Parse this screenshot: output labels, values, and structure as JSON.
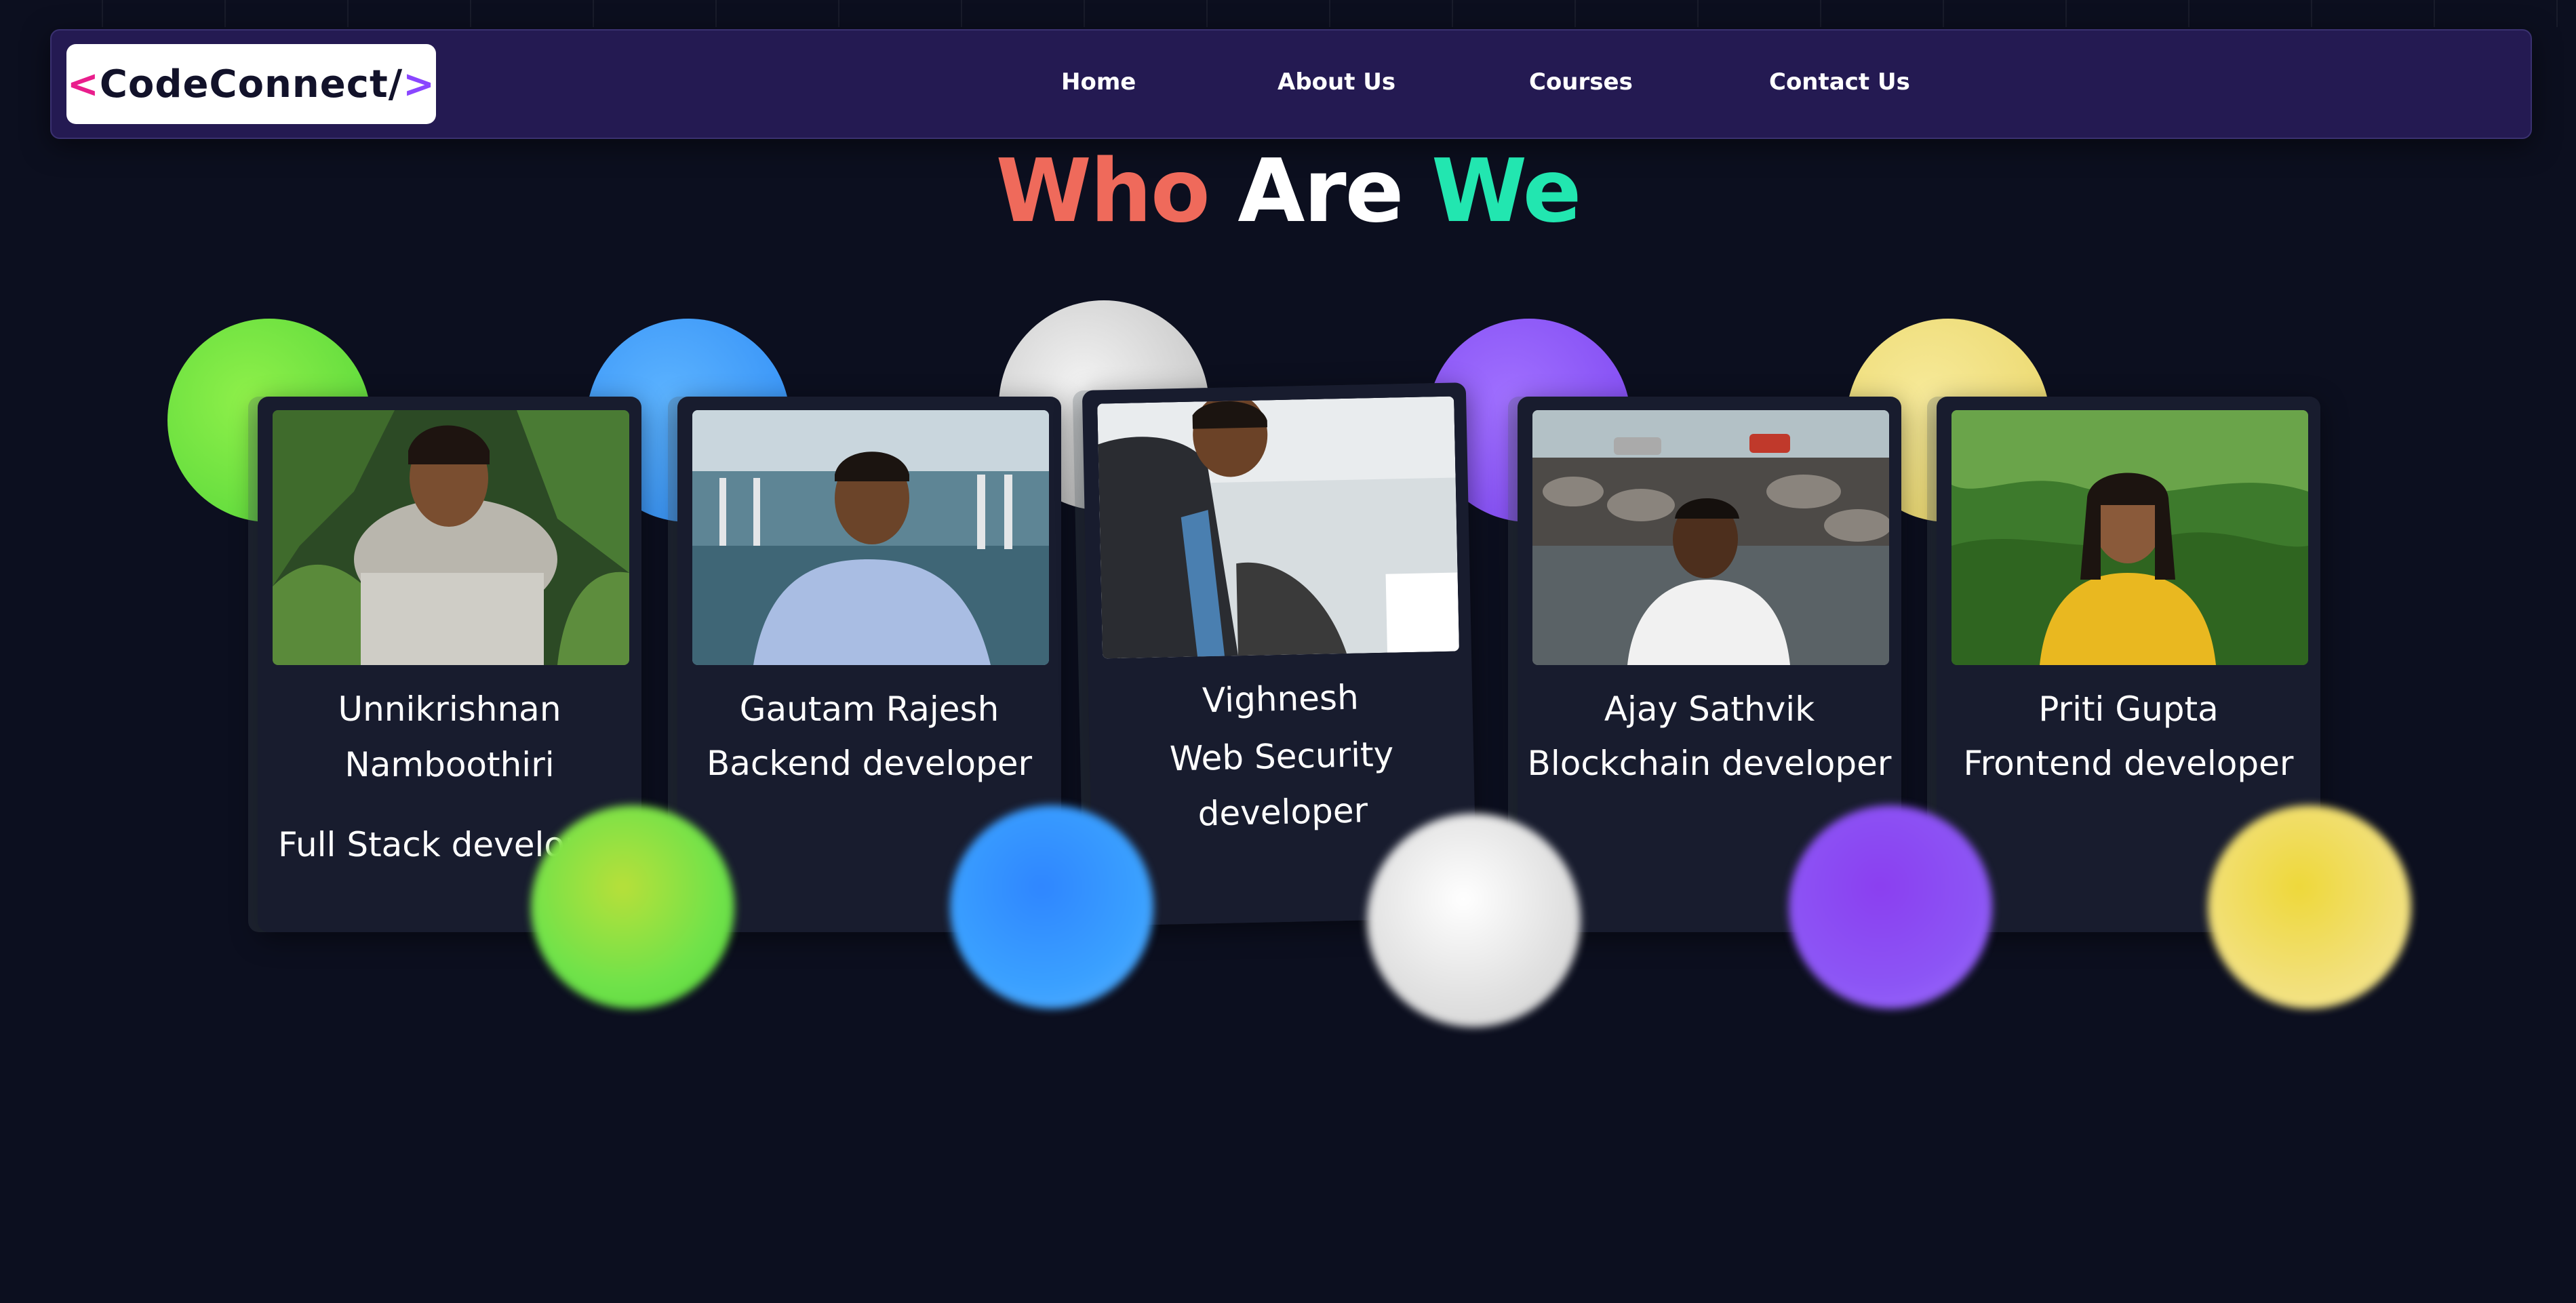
{
  "brand": {
    "logo_open": "<",
    "logo_text": "CodeConnect/",
    "logo_close": ">"
  },
  "nav": {
    "home": "Home",
    "about": "About Us",
    "courses": "Courses",
    "contact": "Contact Us"
  },
  "heading": {
    "word1": "Who",
    "word2": "Are",
    "word3": "We"
  },
  "team": [
    {
      "name": "Unnikrishnan Namboothiri",
      "role": "Full Stack developer",
      "accent": "#6fe24a",
      "photo_desc": "man-in-white-jacket"
    },
    {
      "name": "Gautam Rajesh",
      "role": "Backend developer",
      "accent": "#3aa0ff",
      "photo_desc": "man-in-blue-shirt-at-harbor"
    },
    {
      "name": "Vighnesh",
      "role": "Web Security developer",
      "accent": "#d9d9d9",
      "photo_desc": "man-on-boat"
    },
    {
      "name": "Ajay Sathvik",
      "role": "Blockchain developer",
      "accent": "#8c55f5",
      "photo_desc": "man-on-rocky-shore"
    },
    {
      "name": "Priti Gupta",
      "role": "Frontend developer",
      "accent": "#f2e07a",
      "photo_desc": "woman-in-yellow-top"
    }
  ],
  "colors": {
    "background": "#0c0f1f",
    "navbar": "#241a52",
    "heading_who": "#ef6a5b",
    "heading_are": "#ffffff",
    "heading_we": "#22e6b0"
  }
}
